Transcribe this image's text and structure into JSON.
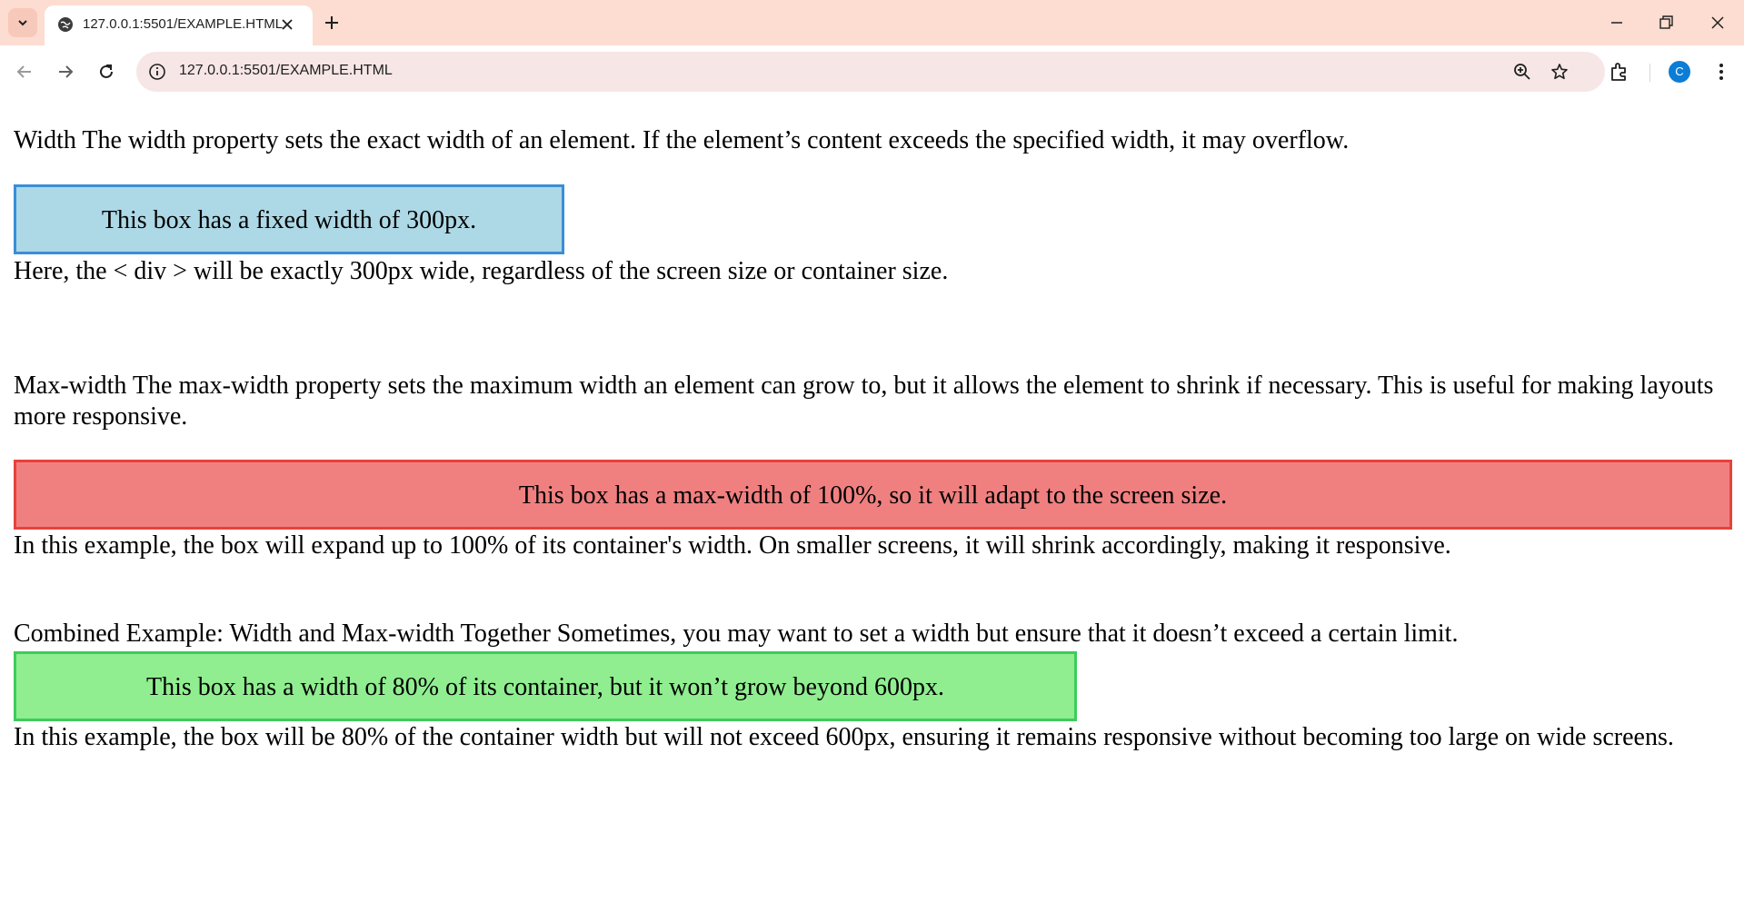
{
  "browser": {
    "tab_title": "127.0.0.1:5501/EXAMPLE.HTML",
    "url": "127.0.0.1:5501/EXAMPLE.HTML",
    "profile_initial": "C"
  },
  "page": {
    "width_intro": "Width The width property sets the exact width of an element. If the element’s content exceeds the specified width, it may overflow.",
    "width_box": "This box has a fixed width of 300px.",
    "width_note": "Here, the < div > will be exactly 300px wide, regardless of the screen size or container size.",
    "maxwidth_intro": "Max-width The max-width property sets the maximum width an element can grow to, but it allows the element to shrink if necessary. This is useful for making layouts more responsive.",
    "maxwidth_box": "This box has a max-width of 100%, so it will adapt to the screen size.",
    "maxwidth_note": "In this example, the box will expand up to 100% of its container's width. On smaller screens, it will shrink accordingly, making it responsive.",
    "combined_intro": "Combined Example: Width and Max-width Together Sometimes, you may want to set a width but ensure that it doesn’t exceed a certain limit.",
    "combined_box": "This box has a width of 80% of its container, but it won’t grow beyond 600px.",
    "combined_note": "In this example, the box will be 80% of the container width but will not exceed 600px, ensuring it remains responsive without becoming too large on wide screens."
  },
  "colors": {
    "tabbar_bg": "#fddcd1",
    "box_blue": "#add8e6",
    "box_red": "#f08080",
    "box_green": "#90ee90"
  }
}
